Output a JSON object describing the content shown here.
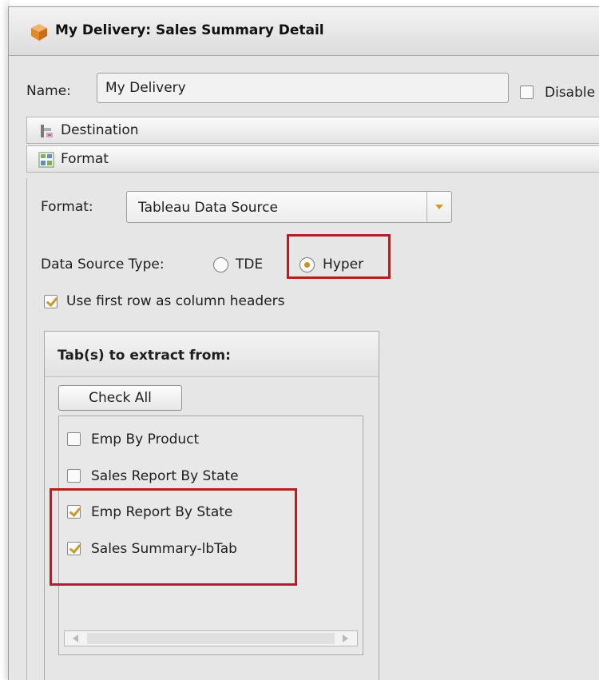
{
  "window": {
    "title": "My Delivery: Sales Summary Detail",
    "icon": "package-icon"
  },
  "name_row": {
    "label": "Name:",
    "value": "My Delivery",
    "disable_label": "Disable",
    "disable_checked": false
  },
  "sections": {
    "destination": {
      "label": "Destination",
      "icon": "destination-icon"
    },
    "format": {
      "label": "Format",
      "icon": "format-icon"
    }
  },
  "format": {
    "format_label": "Format:",
    "format_value": "Tableau Data Source",
    "data_source_type_label": "Data Source Type:",
    "options": [
      {
        "label": "TDE",
        "selected": false
      },
      {
        "label": "Hyper",
        "selected": true
      }
    ],
    "first_row_header_label": "Use first row as column headers",
    "first_row_header_checked": true
  },
  "tabs": {
    "title": "Tab(s) to extract from:",
    "check_all_label": "Check All",
    "items": [
      {
        "label": "Emp By Product",
        "checked": false
      },
      {
        "label": "Sales Report By State",
        "checked": false
      },
      {
        "label": "Emp Report By State",
        "checked": true
      },
      {
        "label": "Sales Summary-lbTab",
        "checked": true
      }
    ]
  },
  "colors": {
    "highlight": "#b31f24",
    "accent": "#c89a2a"
  }
}
